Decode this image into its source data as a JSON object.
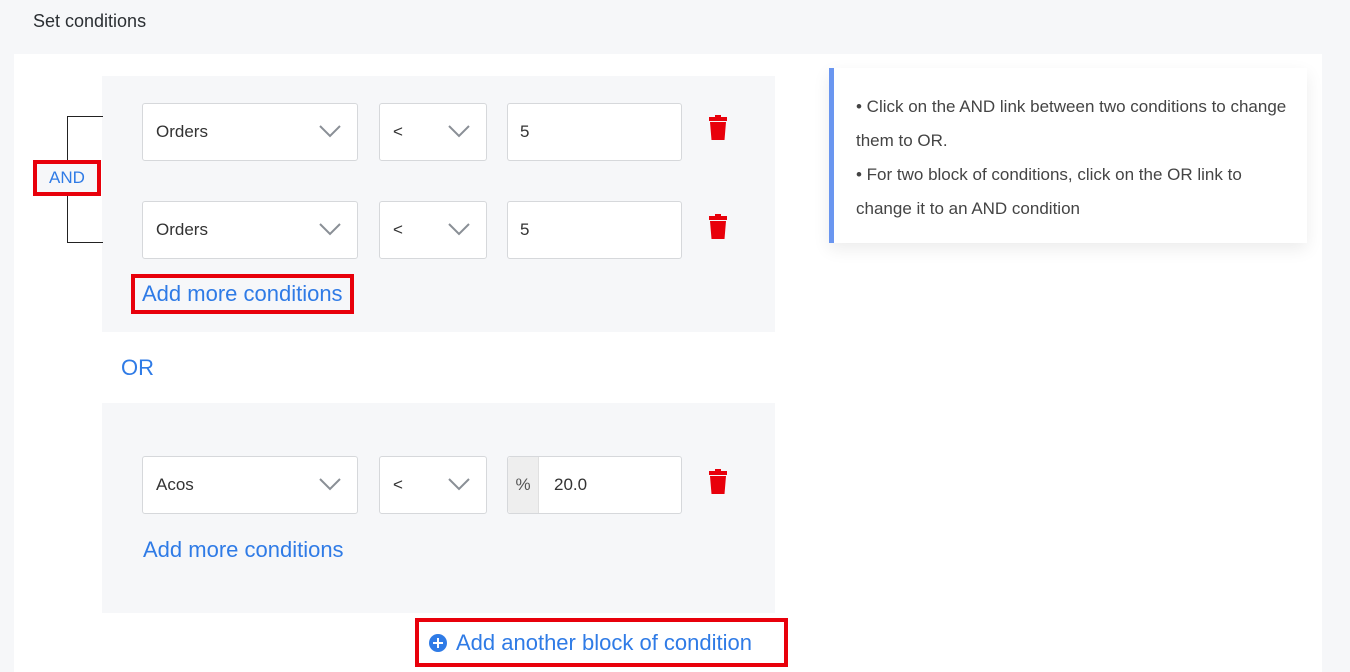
{
  "title": "Set conditions",
  "connector_label": "AND",
  "or_label": "OR",
  "blocks": [
    {
      "conditions": [
        {
          "metric": "Orders",
          "operator": "<",
          "value": "5"
        },
        {
          "metric": "Orders",
          "operator": "<",
          "value": "5"
        }
      ],
      "add_more": "Add more conditions"
    },
    {
      "conditions": [
        {
          "metric": "Acos",
          "operator": "<",
          "unit": "%",
          "value": "20.0"
        }
      ],
      "add_more": "Add more conditions"
    }
  ],
  "add_block": "Add another block of condition",
  "info": {
    "line1": "• Click on the AND link between two conditions to change them to OR.",
    "line2": "• For two block of conditions, click on the OR link to change it to an AND condition"
  },
  "colors": {
    "accent": "#2f7be6",
    "highlight": "#e8000b",
    "delete": "#e8000b",
    "info_border": "#6a96f0"
  },
  "icons": [
    "chevron-down-icon",
    "trash-icon",
    "plus-circle-icon"
  ]
}
